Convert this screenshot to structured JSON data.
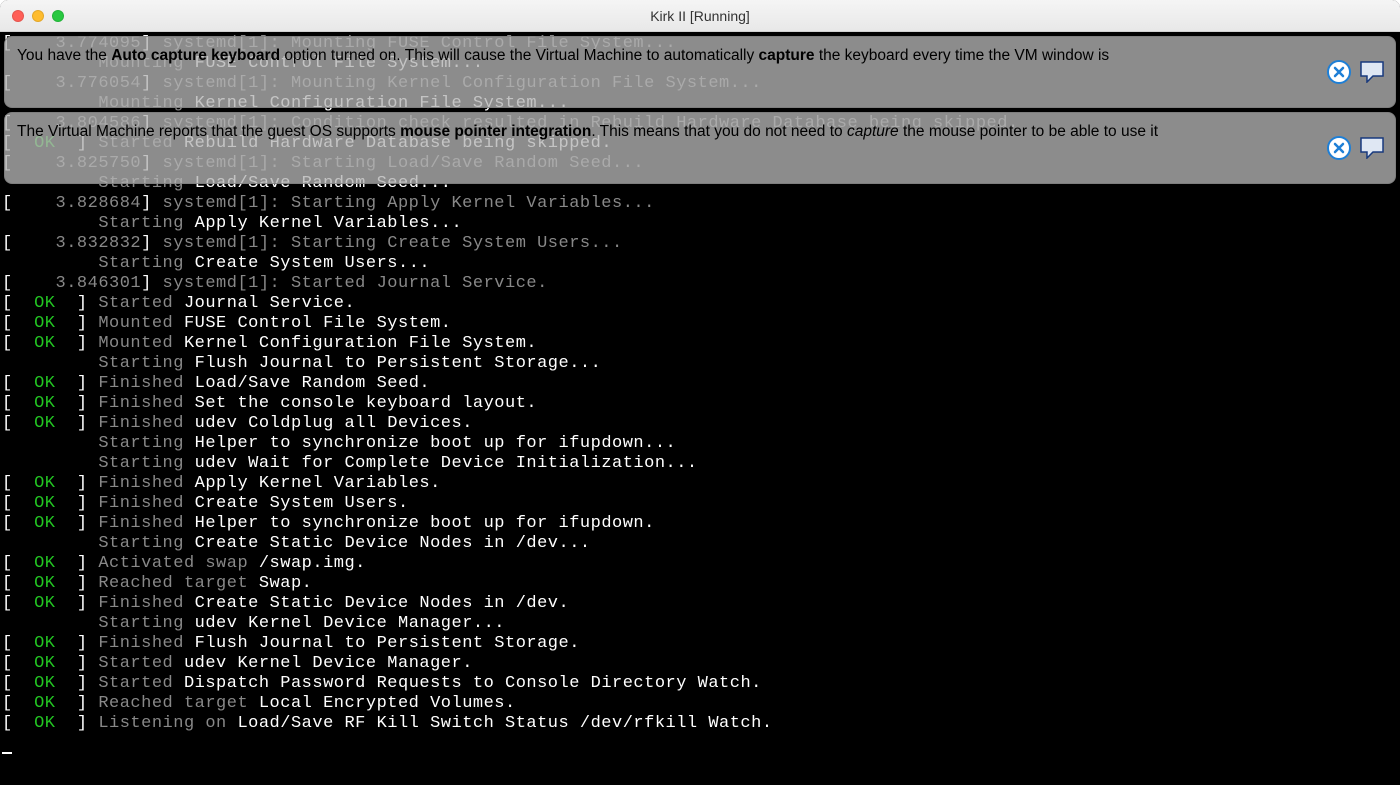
{
  "window": {
    "title": "Kirk II [Running]"
  },
  "notifications": {
    "n1": {
      "pre": "You have the ",
      "b1": "Auto capture keyboard",
      "mid": " option turned on. This will cause the Virtual Machine to automatically ",
      "b2": "capture",
      "post": " the keyboard every time the VM window is"
    },
    "n2": {
      "pre": "The Virtual Machine reports that the guest OS supports ",
      "b1": "mouse pointer integration",
      "mid": ". This means that you do not need to ",
      "i1": "capture",
      "post": " the mouse pointer to be able to use it"
    }
  },
  "icons": {
    "close": "close-icon",
    "callout": "speech-bubble-icon"
  },
  "boot_lines": [
    {
      "type": "kmsg",
      "ts": "3.774095",
      "msg": "Mounting FUSE Control File System..."
    },
    {
      "type": "indent",
      "verb": "Mounting",
      "rest": "FUSE Control File System..."
    },
    {
      "type": "kmsg",
      "ts": "3.776054",
      "msg": "Mounting Kernel Configuration File System..."
    },
    {
      "type": "indent",
      "verb": "Mounting",
      "rest": "Kernel Configuration File System..."
    },
    {
      "type": "kmsg",
      "ts": "3.804586",
      "msg": "Condition check resulted in Rebuild Hardware Database being skipped."
    },
    {
      "type": "ok",
      "verb": "Started",
      "rest": "Rebuild Hardware Database being skipped."
    },
    {
      "type": "kmsg",
      "ts": "3.825750",
      "msg": "Starting Load/Save Random Seed..."
    },
    {
      "type": "indent",
      "verb": "Starting",
      "rest": "Load/Save Random Seed..."
    },
    {
      "type": "kmsg",
      "ts": "3.828684",
      "msg": "Starting Apply Kernel Variables..."
    },
    {
      "type": "indent",
      "verb": "Starting",
      "rest": "Apply Kernel Variables..."
    },
    {
      "type": "kmsg",
      "ts": "3.832832",
      "msg": "Starting Create System Users..."
    },
    {
      "type": "indent",
      "verb": "Starting",
      "rest": "Create System Users..."
    },
    {
      "type": "kmsg",
      "ts": "3.846301",
      "msg": "Started Journal Service."
    },
    {
      "type": "ok",
      "verb": "Started",
      "rest": "Journal Service."
    },
    {
      "type": "ok",
      "verb": "Mounted",
      "rest": "FUSE Control File System."
    },
    {
      "type": "ok",
      "verb": "Mounted",
      "rest": "Kernel Configuration File System."
    },
    {
      "type": "indent",
      "verb": "Starting",
      "rest": "Flush Journal to Persistent Storage..."
    },
    {
      "type": "ok",
      "verb": "Finished",
      "rest": "Load/Save Random Seed."
    },
    {
      "type": "ok",
      "verb": "Finished",
      "rest": "Set the console keyboard layout."
    },
    {
      "type": "ok",
      "verb": "Finished",
      "rest": "udev Coldplug all Devices."
    },
    {
      "type": "indent",
      "verb": "Starting",
      "rest": "Helper to synchronize boot up for ifupdown..."
    },
    {
      "type": "indent",
      "verb": "Starting",
      "rest": "udev Wait for Complete Device Initialization..."
    },
    {
      "type": "ok",
      "verb": "Finished",
      "rest": "Apply Kernel Variables."
    },
    {
      "type": "ok",
      "verb": "Finished",
      "rest": "Create System Users."
    },
    {
      "type": "ok",
      "verb": "Finished",
      "rest": "Helper to synchronize boot up for ifupdown."
    },
    {
      "type": "indent",
      "verb": "Starting",
      "rest": "Create Static Device Nodes in /dev..."
    },
    {
      "type": "ok",
      "verb": "Activated swap",
      "rest": "/swap.img."
    },
    {
      "type": "ok",
      "verb": "Reached target",
      "rest": "Swap."
    },
    {
      "type": "ok",
      "verb": "Finished",
      "rest": "Create Static Device Nodes in /dev."
    },
    {
      "type": "indent",
      "verb": "Starting",
      "rest": "udev Kernel Device Manager..."
    },
    {
      "type": "ok",
      "verb": "Finished",
      "rest": "Flush Journal to Persistent Storage."
    },
    {
      "type": "ok",
      "verb": "Started",
      "rest": "udev Kernel Device Manager."
    },
    {
      "type": "ok",
      "verb": "Started",
      "rest": "Dispatch Password Requests to Console Directory Watch."
    },
    {
      "type": "ok",
      "verb": "Reached target",
      "rest": "Local Encrypted Volumes."
    },
    {
      "type": "ok",
      "verb": "Listening on",
      "rest": "Load/Save RF Kill Switch Status /dev/rfkill Watch."
    }
  ]
}
